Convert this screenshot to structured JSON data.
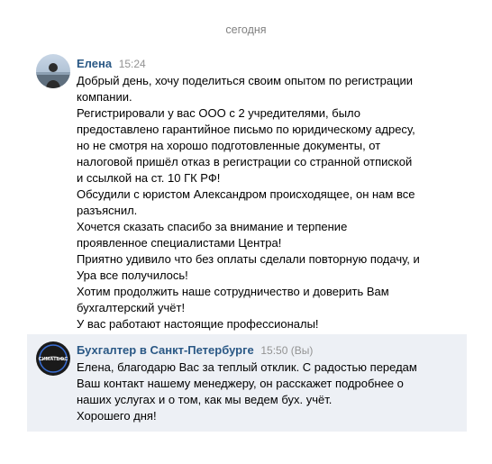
{
  "date_separator": "сегодня",
  "messages": [
    {
      "author": "Елена",
      "time": "15:24",
      "avatar_icon": "user-photo-avatar",
      "lines": [
        "Добрый день, хочу поделиться своим опытом по регистрации",
        "компании.",
        "Регистрировали у вас ООО с 2 учредителями, было",
        "предоставлено гарантийное письмо по юридическому адресу,",
        "но не смотря на хорошо подготовленные документы, от",
        "налоговой пришёл отказ в регистрации со странной отпиской",
        "и ссылкой на ст. 10 ГК РФ!",
        "Обсудили с юристом Александром происходящее, он нам все",
        "разъяснил.",
        "Хочется сказать спасибо за внимание и терпение",
        "проявленное специалистами Центра!",
        "Приятно удивило что без оплаты сделали повторную подачу, и",
        "Ура все получилось!",
        "Хотим продолжить наше сотрудничество и доверить Вам",
        "бухгалтерский учёт!",
        "У вас работают настоящие профессионалы!"
      ]
    },
    {
      "author": "Бухгалтер в Санкт-Петербурге",
      "time": "15:50 (Вы)",
      "avatar_icon": "company-logo-avatar",
      "avatar_logo_text": "СИМАТЬФС",
      "lines": [
        "Елена, благодарю Вас за теплый отклик. С радостью передам",
        "Ваш контакт нашему менеджеру, он расскажет подробнее о",
        "наших услугах и о том, как мы ведем бух. учёт.",
        "Хорошего дня!"
      ]
    }
  ],
  "colors": {
    "author": "#2a5885",
    "time": "#939393",
    "selected_bg": "#edf0f5",
    "date": "#828282"
  }
}
